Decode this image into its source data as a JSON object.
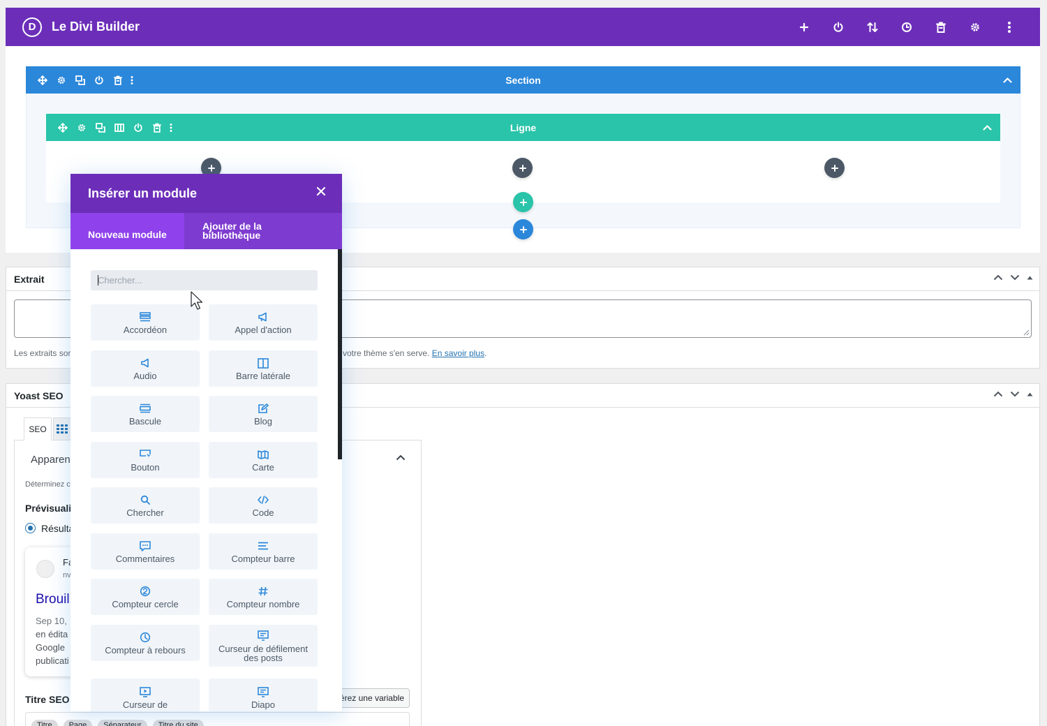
{
  "app": {
    "logo_letter": "D",
    "title": "Le Divi Builder"
  },
  "topbar": {
    "actions": [
      "add-icon",
      "power-icon",
      "sort-icon",
      "history-icon",
      "trash-icon",
      "gear-icon",
      "more-vertical-icon"
    ]
  },
  "section": {
    "label": "Section"
  },
  "row": {
    "label": "Ligne"
  },
  "modal": {
    "title": "Insérer un module",
    "tabs": {
      "new": "Nouveau module",
      "library": "Ajouter de la bibliothèque"
    },
    "search_placeholder": "Chercher...",
    "modules": [
      {
        "label": "Accordéon",
        "icon": "accordion-icon"
      },
      {
        "label": "Appel d'action",
        "icon": "megaphone-icon"
      },
      {
        "label": "Audio",
        "icon": "audio-icon"
      },
      {
        "label": "Barre latérale",
        "icon": "sidebar-icon"
      },
      {
        "label": "Bascule",
        "icon": "toggle-icon"
      },
      {
        "label": "Blog",
        "icon": "blog-icon"
      },
      {
        "label": "Bouton",
        "icon": "button-icon"
      },
      {
        "label": "Carte",
        "icon": "map-icon"
      },
      {
        "label": "Chercher",
        "icon": "search-icon"
      },
      {
        "label": "Code",
        "icon": "code-icon"
      },
      {
        "label": "Commentaires",
        "icon": "comments-icon"
      },
      {
        "label": "Compteur barre",
        "icon": "bar-counter-icon"
      },
      {
        "label": "Compteur cercle",
        "icon": "circle-counter-icon"
      },
      {
        "label": "Compteur nombre",
        "icon": "number-counter-icon"
      },
      {
        "label": "Compteur à rebours",
        "icon": "countdown-icon"
      },
      {
        "label": "Curseur de défilement des posts",
        "icon": "post-slider-icon"
      },
      {
        "label": "Curseur de",
        "icon": "video-slider-icon"
      },
      {
        "label": "Diapo",
        "icon": "slider-icon"
      }
    ]
  },
  "excerpt": {
    "title": "Extrait",
    "help_start": "Les extraits sor",
    "help_end": "votre thème s'en serve.",
    "help_link": "En savoir plus",
    "help_period": "."
  },
  "yoast": {
    "title": "Yoast SEO",
    "tab_seo": "SEO",
    "appearance": "Apparen",
    "determine": "Déterminez c",
    "preview": "Prévisualis",
    "result": "Résulta",
    "snippet_site": "Fa",
    "snippet_url": "nv",
    "snippet_title": "Brouil",
    "snippet_lines": [
      "Sep 10,",
      "en édita",
      "Google",
      "publicati"
    ],
    "seo_title_label": "Titre SEO",
    "insert_variable": "Insérez une variable",
    "pills": [
      "Titre",
      "Page",
      "Séparateur",
      "Titre du site"
    ]
  },
  "colors": {
    "divi_purple": "#6c2eb9",
    "section_blue": "#2b87da",
    "row_green": "#29c4a9",
    "module_dark": "#4c5866",
    "icon_blue": "#2b87da"
  }
}
